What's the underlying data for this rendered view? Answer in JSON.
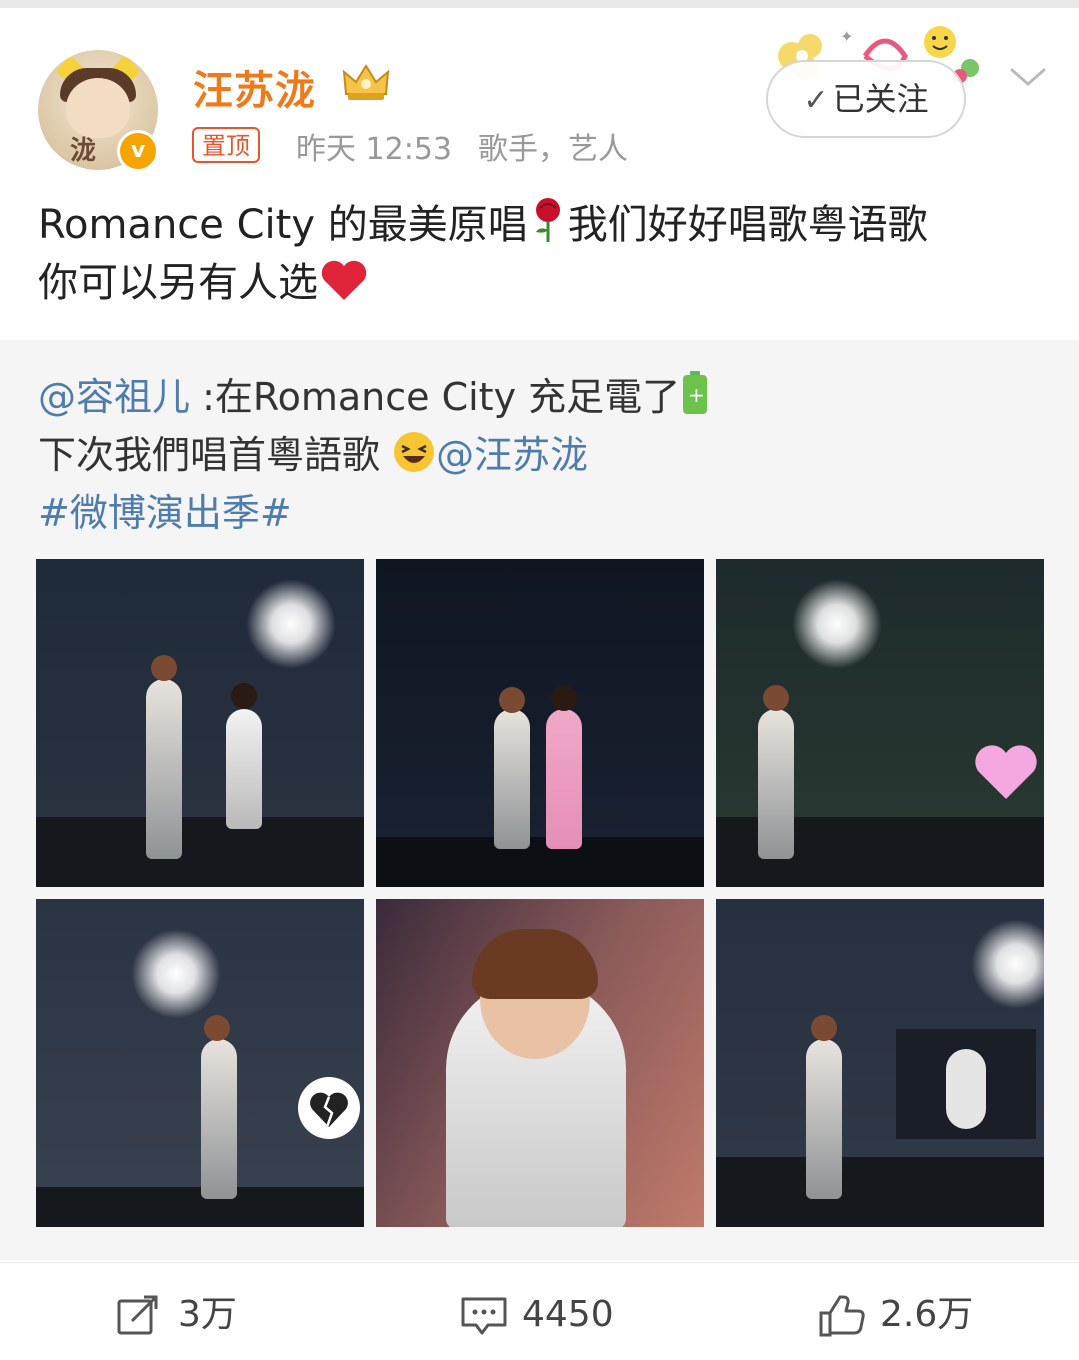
{
  "post": {
    "author": {
      "name": "汪苏泷",
      "avatar_text": "泷",
      "verified_icon": "v-verified-icon",
      "vip_icon": "crown-vip-icon"
    },
    "pinned_label": "置顶",
    "time": "昨天 12:53",
    "author_desc": "歌手，艺人",
    "follow_label": "已关注",
    "text_line1": "Romance City 的最美原唱",
    "text_line1_b": "我们好好唱歌粤语歌",
    "text_line2": "你可以另有人选"
  },
  "retweet": {
    "mention1": "@容祖儿",
    "text1": " :在Romance City 充足電了",
    "text2": "下次我們唱首粵語歌 ",
    "mention2": "@汪苏泷",
    "hashtag": "#微博演出季#",
    "photos": [
      {
        "name": "concert-photo-1"
      },
      {
        "name": "concert-photo-2"
      },
      {
        "name": "concert-photo-3"
      },
      {
        "name": "concert-photo-4"
      },
      {
        "name": "concert-photo-5"
      },
      {
        "name": "concert-photo-6"
      }
    ]
  },
  "actions": {
    "repost": "3万",
    "comment": "4450",
    "like": "2.6万"
  },
  "colors": {
    "username": "#f07a1a",
    "link": "#4f7cae",
    "pinned": "#e8542c",
    "retweet_bg": "#f5f5f5"
  }
}
